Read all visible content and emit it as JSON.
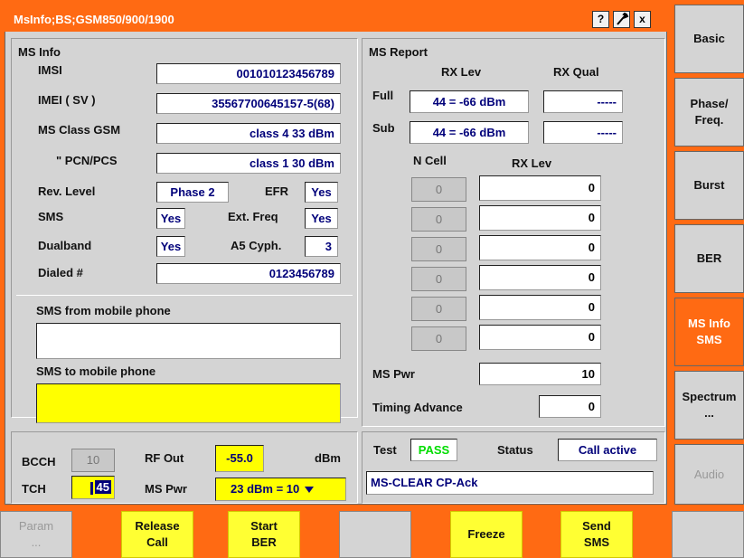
{
  "title": "MsInfo;BS;GSM850/900/1900",
  "title_buttons": {
    "help": "?",
    "tools_icon": "wrench-icon",
    "close": "x"
  },
  "ms_info": {
    "heading": "MS Info",
    "imsi_label": "IMSI",
    "imsi": "001010123456789",
    "imei_label": "IMEI ( SV )",
    "imei": "35567700645157-5(68)",
    "class_gsm_label": "MS Class GSM",
    "class_gsm": "class 4  33 dBm",
    "pcn_label": "\"  PCN/PCS",
    "pcn": "class 1  30 dBm",
    "rev_label": "Rev. Level",
    "rev": "Phase 2",
    "efr_label": "EFR",
    "efr": "Yes",
    "sms_label": "SMS",
    "sms": "Yes",
    "extfreq_label": "Ext. Freq",
    "extfreq": "Yes",
    "dualband_label": "Dualband",
    "dualband": "Yes",
    "a5_label": "A5 Cyph.",
    "a5": "3",
    "dialed_label": "Dialed #",
    "dialed": "0123456789",
    "sms_from_label": "SMS from mobile phone",
    "sms_from": "",
    "sms_to_label": "SMS to mobile phone",
    "sms_to": ""
  },
  "ms_report": {
    "heading": "MS Report",
    "rxlev_header": "RX Lev",
    "rxqual_header": "RX Qual",
    "full_label": "Full",
    "full_rxlev": "44 = -66 dBm",
    "full_rxqual": "-----",
    "sub_label": "Sub",
    "sub_rxlev": "44 = -66 dBm",
    "sub_rxqual": "-----",
    "ncell_header": "N Cell",
    "ncell_rxlev_header": "RX Lev",
    "ncells": [
      {
        "cell": "0",
        "rxlev": "0"
      },
      {
        "cell": "0",
        "rxlev": "0"
      },
      {
        "cell": "0",
        "rxlev": "0"
      },
      {
        "cell": "0",
        "rxlev": "0"
      },
      {
        "cell": "0",
        "rxlev": "0"
      },
      {
        "cell": "0",
        "rxlev": "0"
      }
    ],
    "mspwr_label": "MS Pwr",
    "mspwr": "10",
    "ta_label": "Timing Advance",
    "ta": "0"
  },
  "bottom_left": {
    "bcch_label": "BCCH",
    "bcch": "10",
    "tch_label": "TCH",
    "tch": "45",
    "rfout_label": "RF Out",
    "rfout": "-55.0",
    "rfout_unit": "dBm",
    "mspwr_label": "MS Pwr",
    "mspwr": "23 dBm = 10"
  },
  "bottom_right": {
    "test_label": "Test",
    "test": "PASS",
    "status_label": "Status",
    "status": "Call active",
    "message": "MS-CLEAR  CP-Ack"
  },
  "side_buttons": [
    "Basic",
    "Phase/\nFreq.",
    "Burst",
    "BER",
    "MS Info\nSMS",
    "Spectrum\n...",
    "Audio"
  ],
  "softkeys": [
    "Param\n...",
    "Release\nCall",
    "Start\nBER",
    "",
    "Freeze",
    "Send\nSMS",
    ""
  ],
  "colors": {
    "accent": "#ff6a13",
    "panel": "#d4d4d4",
    "value_text": "#00007a",
    "pass": "#00dd00",
    "highlight": "#ffff00"
  }
}
